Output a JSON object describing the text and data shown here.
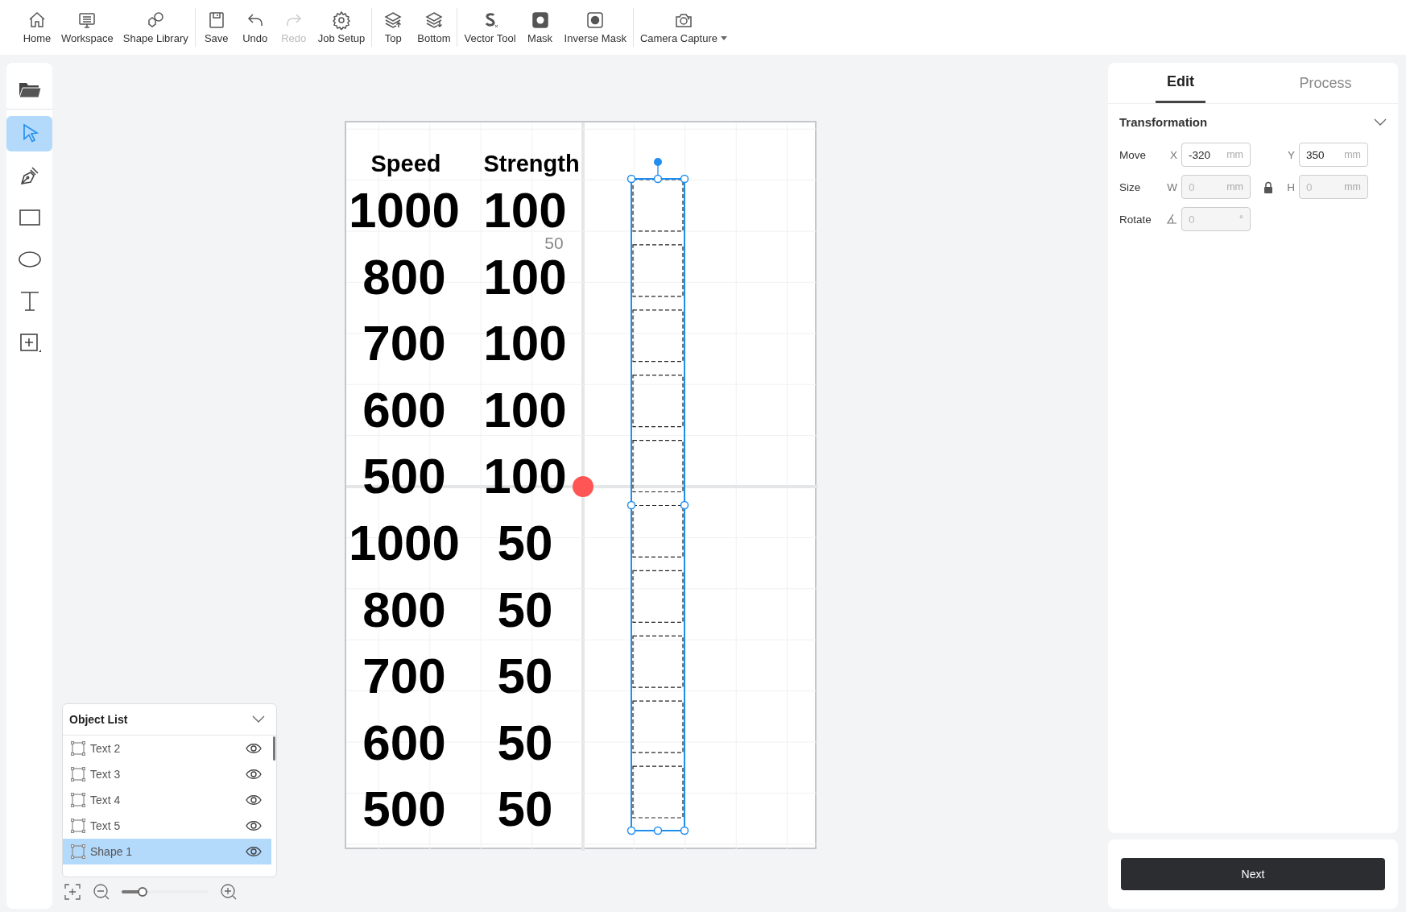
{
  "toolbar": [
    {
      "items": [
        {
          "kind": "home",
          "label": "Home",
          "disabled": false
        },
        {
          "kind": "workspace",
          "label": "Workspace",
          "disabled": false
        },
        {
          "kind": "shapes",
          "label": "Shape Library",
          "disabled": false
        }
      ]
    },
    {
      "items": [
        {
          "kind": "save",
          "label": "Save",
          "disabled": false
        },
        {
          "kind": "undo",
          "label": "Undo",
          "disabled": false
        },
        {
          "kind": "redo",
          "label": "Redo",
          "disabled": true
        },
        {
          "kind": "gear",
          "label": "Job Setup",
          "disabled": false
        }
      ]
    },
    {
      "items": [
        {
          "kind": "top",
          "label": "Top",
          "disabled": false
        },
        {
          "kind": "bottom",
          "label": "Bottom",
          "disabled": false
        }
      ]
    },
    {
      "items": [
        {
          "kind": "vector",
          "label": "Vector Tool",
          "disabled": false
        },
        {
          "kind": "mask",
          "label": "Mask",
          "disabled": false
        },
        {
          "kind": "inverse",
          "label": "Inverse Mask",
          "disabled": false
        }
      ]
    },
    {
      "items": [
        {
          "kind": "camera",
          "label": "Camera Capture",
          "disabled": false,
          "dropdown": true
        }
      ]
    }
  ],
  "tools": [
    {
      "kind": "folder",
      "selected": false
    },
    {
      "kind": "select",
      "selected": true
    },
    {
      "kind": "pen",
      "selected": false
    },
    {
      "kind": "rectangle",
      "selected": false
    },
    {
      "kind": "ellipse",
      "selected": false
    },
    {
      "kind": "text",
      "selected": false
    },
    {
      "kind": "frame",
      "selected": false
    }
  ],
  "canvas": {
    "headers": [
      "Speed",
      "Strength"
    ],
    "rows": [
      [
        "1000",
        "100"
      ],
      [
        "800",
        "100"
      ],
      [
        "700",
        "100"
      ],
      [
        "600",
        "100"
      ],
      [
        "500",
        "100"
      ],
      [
        "1000",
        "50"
      ],
      [
        "800",
        "50"
      ],
      [
        "700",
        "50"
      ],
      [
        "600",
        "50"
      ],
      [
        "500",
        "50"
      ]
    ],
    "ruler_label": "50"
  },
  "object_list": {
    "title": "Object List",
    "items": [
      {
        "name": "Text 2",
        "selected": false
      },
      {
        "name": "Text 3",
        "selected": false
      },
      {
        "name": "Text 4",
        "selected": false
      },
      {
        "name": "Text 5",
        "selected": false
      },
      {
        "name": "Shape 1",
        "selected": true
      }
    ]
  },
  "zoom": {
    "level": 0.24
  },
  "panel": {
    "tabs": [
      {
        "label": "Edit",
        "selected": true
      },
      {
        "label": "Process",
        "selected": false
      }
    ],
    "section": {
      "title": "Transformation",
      "expanded": true,
      "rows": [
        {
          "kind": "move",
          "label": "Move",
          "fields": [
            {
              "axis": "X",
              "value": "-320",
              "unit": "mm",
              "disabled": false
            },
            {
              "axis": "Y",
              "value": "350",
              "unit": "mm",
              "disabled": false
            }
          ]
        },
        {
          "kind": "size",
          "label": "Size",
          "fields": [
            {
              "axis": "W",
              "value": "0",
              "unit": "mm",
              "disabled": true
            },
            {
              "axis": "H",
              "value": "0",
              "unit": "mm",
              "disabled": true
            }
          ]
        },
        {
          "kind": "rotate",
          "label": "Rotate",
          "fields": [
            {
              "value": "0",
              "unit": "°",
              "disabled": true
            }
          ]
        }
      ]
    }
  },
  "next_button": "Next"
}
